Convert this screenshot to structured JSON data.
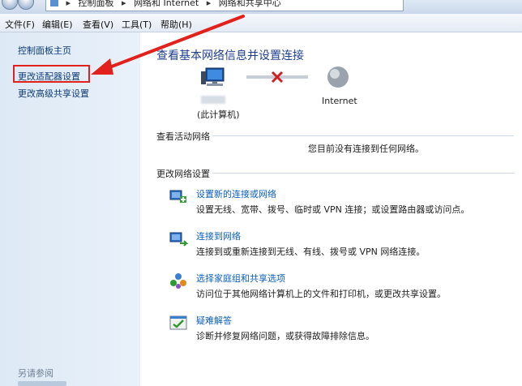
{
  "breadcrumb": {
    "items": [
      "控制面板",
      "网络和 Internet",
      "网络和共享中心"
    ],
    "separator": "▸"
  },
  "menubar": {
    "file": "文件(F)",
    "edit": "编辑(E)",
    "view": "查看(V)",
    "tools": "工具(T)",
    "help": "帮助(H)"
  },
  "sidebar": {
    "items": [
      {
        "label": "控制面板主页"
      },
      {
        "label": "更改适配器设置"
      },
      {
        "label": "更改高级共享设置"
      }
    ],
    "see_also": "另请参阅"
  },
  "main": {
    "title": "查看基本网络信息并设置连接",
    "network_map": {
      "this_computer": "(此计算机)",
      "internet": "Internet"
    },
    "active_networks_heading": "查看活动网络",
    "no_connection_message": "您目前没有连接到任何网络。",
    "change_settings_heading": "更改网络设置",
    "tasks": [
      {
        "icon": "new-connection-icon",
        "title": "设置新的连接或网络",
        "desc": "设置无线、宽带、拨号、临时或 VPN 连接；或设置路由器或访问点。"
      },
      {
        "icon": "connect-network-icon",
        "title": "连接到网络",
        "desc": "连接到或重新连接到无线、有线、拨号或 VPN 网络连接。"
      },
      {
        "icon": "homegroup-icon",
        "title": "选择家庭组和共享选项",
        "desc": "访问位于其他网络计算机上的文件和打印机，或更改共享设置。"
      },
      {
        "icon": "troubleshoot-icon",
        "title": "疑难解答",
        "desc": "诊断并修复网络问题，或获得故障排除信息。"
      }
    ]
  },
  "colors": {
    "link": "#0a5fbd",
    "title": "#1e3e8c",
    "annotation_red": "#e2211c"
  }
}
